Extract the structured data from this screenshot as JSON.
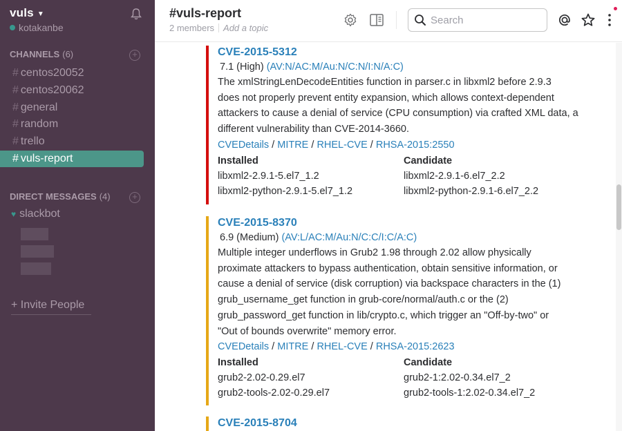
{
  "sidebar": {
    "team_name": "vuls",
    "user_name": "kotakanbe",
    "channels_header": "CHANNELS",
    "channels_count": "(6)",
    "channels": [
      {
        "name": "centos20052"
      },
      {
        "name": "centos20062"
      },
      {
        "name": "general"
      },
      {
        "name": "random"
      },
      {
        "name": "trello"
      },
      {
        "name": "vuls-report",
        "active": true
      }
    ],
    "dm_header": "DIRECT MESSAGES",
    "dm_count": "(4)",
    "dms": [
      {
        "name": "slackbot"
      }
    ],
    "invite_label": "+ Invite People"
  },
  "header": {
    "channel_title": "#vuls-report",
    "members": "2 members",
    "topic_placeholder": "Add a topic",
    "search_placeholder": "Search"
  },
  "attachments": [
    {
      "color": "#d40e0d",
      "title": "CVE-2015-5312",
      "score": "7.1 (High)",
      "vector": "(AV:N/AC:M/Au:N/C:N/I:N/A:C)",
      "description": [
        "The xmlStringLenDecodeEntities function in parser.c in libxml2 before 2.9.3",
        "does not properly prevent entity expansion, which allows context-dependent",
        "attackers to cause a denial of service (CPU consumption) via crafted XML data, a",
        "different vulnerability than CVE-2014-3660."
      ],
      "links": [
        "CVEDetails",
        "MITRE",
        "RHEL-CVE",
        "RHSA-2015:2550"
      ],
      "installed_header": "Installed",
      "candidate_header": "Candidate",
      "packages": [
        {
          "installed": "libxml2-2.9.1-5.el7_1.2",
          "candidate": "libxml2-2.9.1-6.el7_2.2"
        },
        {
          "installed": "libxml2-python-2.9.1-5.el7_1.2",
          "candidate": "libxml2-python-2.9.1-6.el7_2.2"
        }
      ]
    },
    {
      "color": "#e6a817",
      "title": "CVE-2015-8370",
      "score": "6.9 (Medium)",
      "vector": "(AV:L/AC:M/Au:N/C:C/I:C/A:C)",
      "description": [
        "Multiple integer underflows in Grub2 1.98 through 2.02 allow physically",
        "proximate attackers to bypass authentication, obtain sensitive information, or",
        "cause a denial of service (disk corruption) via backspace characters in the (1)",
        "grub_username_get function in grub-core/normal/auth.c or the (2)",
        "grub_password_get function in lib/crypto.c, which trigger an \"Off-by-two\" or",
        "\"Out of bounds overwrite\" memory error."
      ],
      "links": [
        "CVEDetails",
        "MITRE",
        "RHEL-CVE",
        "RHSA-2015:2623"
      ],
      "installed_header": "Installed",
      "candidate_header": "Candidate",
      "packages": [
        {
          "installed": "grub2-2.02-0.29.el7",
          "candidate": "grub2-1:2.02-0.34.el7_2"
        },
        {
          "installed": "grub2-tools-2.02-0.29.el7",
          "candidate": "grub2-tools-1:2.02-0.34.el7_2"
        }
      ]
    },
    {
      "color": "#e6a817",
      "title": "CVE-2015-8704"
    }
  ]
}
